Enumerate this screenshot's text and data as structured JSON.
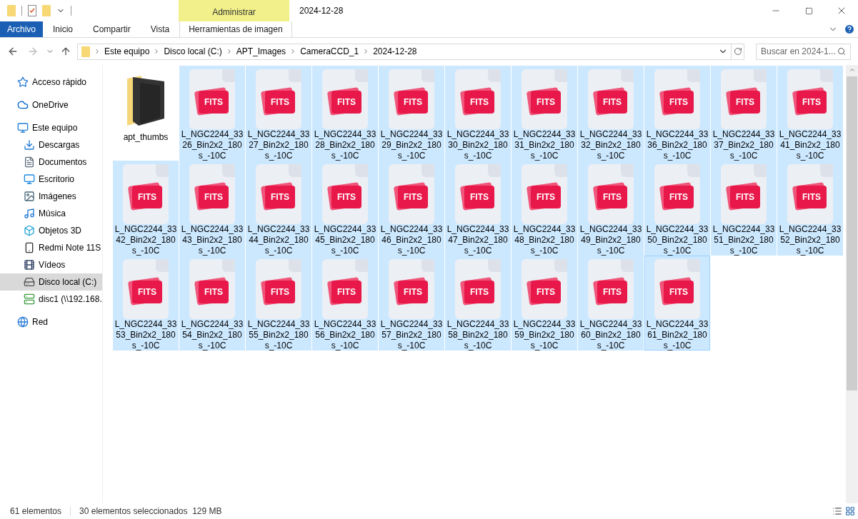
{
  "window": {
    "title": "2024-12-28",
    "context_tab": "Administrar"
  },
  "ribbon_tabs": [
    {
      "label": "Archivo",
      "kind": "file",
      "selected": false
    },
    {
      "label": "Inicio",
      "kind": "tab",
      "selected": false
    },
    {
      "label": "Compartir",
      "kind": "tab",
      "selected": false
    },
    {
      "label": "Vista",
      "kind": "tab",
      "selected": false
    },
    {
      "label": "Herramientas de imagen",
      "kind": "context",
      "selected": false
    }
  ],
  "breadcrumb": [
    "Este equipo",
    "Disco local (C:)",
    "APT_Images",
    "CameraCCD_1",
    "2024-12-28"
  ],
  "search": {
    "placeholder": "Buscar en 2024-1..."
  },
  "sidebar": [
    {
      "label": "Acceso rápido",
      "selected": false
    },
    {
      "label": "OneDrive",
      "selected": false
    },
    {
      "label": "Este equipo",
      "selected": false,
      "children": [
        {
          "label": "Descargas",
          "selected": false
        },
        {
          "label": "Documentos",
          "selected": false
        },
        {
          "label": "Escritorio",
          "selected": false
        },
        {
          "label": "Imágenes",
          "selected": false
        },
        {
          "label": "Música",
          "selected": false
        },
        {
          "label": "Objetos 3D",
          "selected": false
        },
        {
          "label": "Redmi Note 11S",
          "selected": false
        },
        {
          "label": "Vídeos",
          "selected": false
        },
        {
          "label": "Disco local (C:)",
          "selected": true
        },
        {
          "label": "disc1 (\\\\192.168.",
          "selected": false
        }
      ]
    },
    {
      "label": "Red",
      "selected": false
    }
  ],
  "files": [
    {
      "kind": "folder",
      "name_lines": [
        "apt_thumbs"
      ],
      "selected": false,
      "focused": false
    },
    {
      "kind": "fits",
      "icon_label": "FITS",
      "name_lines": [
        "L_NGC2244_33",
        "26_Bin2x2_180",
        "s_-10C"
      ],
      "selected": true,
      "focused": false
    },
    {
      "kind": "fits",
      "icon_label": "FITS",
      "name_lines": [
        "L_NGC2244_33",
        "27_Bin2x2_180",
        "s_-10C"
      ],
      "selected": true,
      "focused": false
    },
    {
      "kind": "fits",
      "icon_label": "FITS",
      "name_lines": [
        "L_NGC2244_33",
        "28_Bin2x2_180",
        "s_-10C"
      ],
      "selected": true,
      "focused": false
    },
    {
      "kind": "fits",
      "icon_label": "FITS",
      "name_lines": [
        "L_NGC2244_33",
        "29_Bin2x2_180",
        "s_-10C"
      ],
      "selected": true,
      "focused": false
    },
    {
      "kind": "fits",
      "icon_label": "FITS",
      "name_lines": [
        "L_NGC2244_33",
        "30_Bin2x2_180",
        "s_-10C"
      ],
      "selected": true,
      "focused": false
    },
    {
      "kind": "fits",
      "icon_label": "FITS",
      "name_lines": [
        "L_NGC2244_33",
        "31_Bin2x2_180",
        "s_-10C"
      ],
      "selected": true,
      "focused": false
    },
    {
      "kind": "fits",
      "icon_label": "FITS",
      "name_lines": [
        "L_NGC2244_33",
        "32_Bin2x2_180",
        "s_-10C"
      ],
      "selected": true,
      "focused": false
    },
    {
      "kind": "fits",
      "icon_label": "FITS",
      "name_lines": [
        "L_NGC2244_33",
        "36_Bin2x2_180",
        "s_-10C"
      ],
      "selected": true,
      "focused": false
    },
    {
      "kind": "fits",
      "icon_label": "FITS",
      "name_lines": [
        "L_NGC2244_33",
        "37_Bin2x2_180",
        "s_-10C"
      ],
      "selected": true,
      "focused": false
    },
    {
      "kind": "fits",
      "icon_label": "FITS",
      "name_lines": [
        "L_NGC2244_33",
        "41_Bin2x2_180",
        "s_-10C"
      ],
      "selected": true,
      "focused": false
    },
    {
      "kind": "fits",
      "icon_label": "FITS",
      "name_lines": [
        "L_NGC2244_33",
        "42_Bin2x2_180",
        "s_-10C"
      ],
      "selected": true,
      "focused": false
    },
    {
      "kind": "fits",
      "icon_label": "FITS",
      "name_lines": [
        "L_NGC2244_33",
        "43_Bin2x2_180",
        "s_-10C"
      ],
      "selected": true,
      "focused": false
    },
    {
      "kind": "fits",
      "icon_label": "FITS",
      "name_lines": [
        "L_NGC2244_33",
        "44_Bin2x2_180",
        "s_-10C"
      ],
      "selected": true,
      "focused": false
    },
    {
      "kind": "fits",
      "icon_label": "FITS",
      "name_lines": [
        "L_NGC2244_33",
        "45_Bin2x2_180",
        "s_-10C"
      ],
      "selected": true,
      "focused": false
    },
    {
      "kind": "fits",
      "icon_label": "FITS",
      "name_lines": [
        "L_NGC2244_33",
        "46_Bin2x2_180",
        "s_-10C"
      ],
      "selected": true,
      "focused": false
    },
    {
      "kind": "fits",
      "icon_label": "FITS",
      "name_lines": [
        "L_NGC2244_33",
        "47_Bin2x2_180",
        "s_-10C"
      ],
      "selected": true,
      "focused": false
    },
    {
      "kind": "fits",
      "icon_label": "FITS",
      "name_lines": [
        "L_NGC2244_33",
        "48_Bin2x2_180",
        "s_-10C"
      ],
      "selected": true,
      "focused": false
    },
    {
      "kind": "fits",
      "icon_label": "FITS",
      "name_lines": [
        "L_NGC2244_33",
        "49_Bin2x2_180",
        "s_-10C"
      ],
      "selected": true,
      "focused": false
    },
    {
      "kind": "fits",
      "icon_label": "FITS",
      "name_lines": [
        "L_NGC2244_33",
        "50_Bin2x2_180",
        "s_-10C"
      ],
      "selected": true,
      "focused": false
    },
    {
      "kind": "fits",
      "icon_label": "FITS",
      "name_lines": [
        "L_NGC2244_33",
        "51_Bin2x2_180",
        "s_-10C"
      ],
      "selected": true,
      "focused": false
    },
    {
      "kind": "fits",
      "icon_label": "FITS",
      "name_lines": [
        "L_NGC2244_33",
        "52_Bin2x2_180",
        "s_-10C"
      ],
      "selected": true,
      "focused": false
    },
    {
      "kind": "fits",
      "icon_label": "FITS",
      "name_lines": [
        "L_NGC2244_33",
        "53_Bin2x2_180",
        "s_-10C"
      ],
      "selected": true,
      "focused": false
    },
    {
      "kind": "fits",
      "icon_label": "FITS",
      "name_lines": [
        "L_NGC2244_33",
        "54_Bin2x2_180",
        "s_-10C"
      ],
      "selected": true,
      "focused": false
    },
    {
      "kind": "fits",
      "icon_label": "FITS",
      "name_lines": [
        "L_NGC2244_33",
        "55_Bin2x2_180",
        "s_-10C"
      ],
      "selected": true,
      "focused": false
    },
    {
      "kind": "fits",
      "icon_label": "FITS",
      "name_lines": [
        "L_NGC2244_33",
        "56_Bin2x2_180",
        "s_-10C"
      ],
      "selected": true,
      "focused": false
    },
    {
      "kind": "fits",
      "icon_label": "FITS",
      "name_lines": [
        "L_NGC2244_33",
        "57_Bin2x2_180",
        "s_-10C"
      ],
      "selected": true,
      "focused": false
    },
    {
      "kind": "fits",
      "icon_label": "FITS",
      "name_lines": [
        "L_NGC2244_33",
        "58_Bin2x2_180",
        "s_-10C"
      ],
      "selected": true,
      "focused": false
    },
    {
      "kind": "fits",
      "icon_label": "FITS",
      "name_lines": [
        "L_NGC2244_33",
        "59_Bin2x2_180",
        "s_-10C"
      ],
      "selected": true,
      "focused": false
    },
    {
      "kind": "fits",
      "icon_label": "FITS",
      "name_lines": [
        "L_NGC2244_33",
        "60_Bin2x2_180",
        "s_-10C"
      ],
      "selected": true,
      "focused": false
    },
    {
      "kind": "fits",
      "icon_label": "FITS",
      "name_lines": [
        "L_NGC2244_33",
        "61_Bin2x2_180",
        "s_-10C"
      ],
      "selected": true,
      "focused": true
    }
  ],
  "status_bar": {
    "count": "61 elementos",
    "selection": "30 elementos seleccionados  129 MB"
  }
}
